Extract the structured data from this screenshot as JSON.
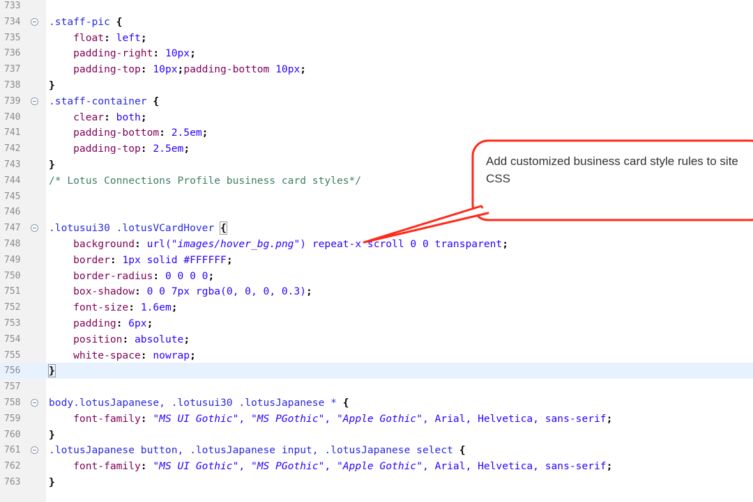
{
  "editor": {
    "lines": [
      {
        "n": "733",
        "fold": false,
        "tokens": []
      },
      {
        "n": "734",
        "fold": true,
        "tokens": [
          {
            "c": "sel",
            "t": ".staff-pic "
          },
          {
            "c": "br",
            "t": "{"
          }
        ]
      },
      {
        "n": "735",
        "fold": false,
        "tokens": [
          {
            "c": "prop",
            "t": "    float"
          },
          {
            "c": "br",
            "t": ": "
          },
          {
            "c": "val",
            "t": "left"
          },
          {
            "c": "br",
            "t": ";"
          }
        ]
      },
      {
        "n": "736",
        "fold": false,
        "tokens": [
          {
            "c": "prop",
            "t": "    padding-right"
          },
          {
            "c": "br",
            "t": ": "
          },
          {
            "c": "val",
            "t": "10px"
          },
          {
            "c": "br",
            "t": ";"
          }
        ]
      },
      {
        "n": "737",
        "fold": false,
        "tokens": [
          {
            "c": "prop",
            "t": "    padding-top"
          },
          {
            "c": "br",
            "t": ": "
          },
          {
            "c": "val",
            "t": "10px"
          },
          {
            "c": "br",
            "t": ";"
          },
          {
            "c": "prop",
            "t": "padding-bottom "
          },
          {
            "c": "val",
            "t": "10px"
          },
          {
            "c": "br",
            "t": ";"
          }
        ]
      },
      {
        "n": "738",
        "fold": false,
        "tokens": [
          {
            "c": "br",
            "t": "}"
          }
        ]
      },
      {
        "n": "739",
        "fold": true,
        "tokens": [
          {
            "c": "sel",
            "t": ".staff-container "
          },
          {
            "c": "br",
            "t": "{"
          }
        ]
      },
      {
        "n": "740",
        "fold": false,
        "tokens": [
          {
            "c": "prop",
            "t": "    clear"
          },
          {
            "c": "br",
            "t": ": "
          },
          {
            "c": "val",
            "t": "both"
          },
          {
            "c": "br",
            "t": ";"
          }
        ]
      },
      {
        "n": "741",
        "fold": false,
        "tokens": [
          {
            "c": "prop",
            "t": "    padding-bottom"
          },
          {
            "c": "br",
            "t": ": "
          },
          {
            "c": "val",
            "t": "2.5em"
          },
          {
            "c": "br",
            "t": ";"
          }
        ]
      },
      {
        "n": "742",
        "fold": false,
        "tokens": [
          {
            "c": "prop",
            "t": "    padding-top"
          },
          {
            "c": "br",
            "t": ": "
          },
          {
            "c": "val",
            "t": "2.5em"
          },
          {
            "c": "br",
            "t": ";"
          }
        ]
      },
      {
        "n": "743",
        "fold": false,
        "tokens": [
          {
            "c": "br",
            "t": "}"
          }
        ]
      },
      {
        "n": "744",
        "fold": false,
        "tokens": [
          {
            "c": "com",
            "t": "/* Lotus Connections Profile business card styles*/"
          }
        ]
      },
      {
        "n": "745",
        "fold": false,
        "tokens": []
      },
      {
        "n": "746",
        "fold": false,
        "tokens": []
      },
      {
        "n": "747",
        "fold": true,
        "tokens": [
          {
            "c": "sel",
            "t": ".lotusui30 .lotusVCardHover "
          },
          {
            "c": "br bracebox",
            "t": "{"
          }
        ]
      },
      {
        "n": "748",
        "fold": false,
        "tokens": [
          {
            "c": "prop",
            "t": "    background"
          },
          {
            "c": "br",
            "t": ": "
          },
          {
            "c": "val",
            "t": "url("
          },
          {
            "c": "str",
            "t": "\"images/hover_bg.png\""
          },
          {
            "c": "val",
            "t": ") repeat-x scroll 0 0 transparent"
          },
          {
            "c": "br",
            "t": ";"
          }
        ]
      },
      {
        "n": "749",
        "fold": false,
        "tokens": [
          {
            "c": "prop",
            "t": "    border"
          },
          {
            "c": "br",
            "t": ": "
          },
          {
            "c": "val",
            "t": "1px solid #FFFFFF"
          },
          {
            "c": "br",
            "t": ";"
          }
        ]
      },
      {
        "n": "750",
        "fold": false,
        "tokens": [
          {
            "c": "prop",
            "t": "    border-radius"
          },
          {
            "c": "br",
            "t": ": "
          },
          {
            "c": "val",
            "t": "0 0 0 0"
          },
          {
            "c": "br",
            "t": ";"
          }
        ]
      },
      {
        "n": "751",
        "fold": false,
        "tokens": [
          {
            "c": "prop",
            "t": "    box-shadow"
          },
          {
            "c": "br",
            "t": ": "
          },
          {
            "c": "val",
            "t": "0 0 7px rgba(0, 0, 0, 0.3)"
          },
          {
            "c": "br",
            "t": ";"
          }
        ]
      },
      {
        "n": "752",
        "fold": false,
        "tokens": [
          {
            "c": "prop",
            "t": "    font-size"
          },
          {
            "c": "br",
            "t": ": "
          },
          {
            "c": "val",
            "t": "1.6em"
          },
          {
            "c": "br",
            "t": ";"
          }
        ]
      },
      {
        "n": "753",
        "fold": false,
        "tokens": [
          {
            "c": "prop",
            "t": "    padding"
          },
          {
            "c": "br",
            "t": ": "
          },
          {
            "c": "val",
            "t": "6px"
          },
          {
            "c": "br",
            "t": ";"
          }
        ]
      },
      {
        "n": "754",
        "fold": false,
        "tokens": [
          {
            "c": "prop",
            "t": "    position"
          },
          {
            "c": "br",
            "t": ": "
          },
          {
            "c": "val",
            "t": "absolute"
          },
          {
            "c": "br",
            "t": ";"
          }
        ]
      },
      {
        "n": "755",
        "fold": false,
        "tokens": [
          {
            "c": "prop",
            "t": "    white-space"
          },
          {
            "c": "br",
            "t": ": "
          },
          {
            "c": "val",
            "t": "nowrap"
          },
          {
            "c": "br",
            "t": ";"
          }
        ]
      },
      {
        "n": "756",
        "fold": false,
        "current": true,
        "tokens": [
          {
            "c": "br bracebox",
            "t": "}"
          }
        ]
      },
      {
        "n": "757",
        "fold": false,
        "tokens": []
      },
      {
        "n": "758",
        "fold": true,
        "tokens": [
          {
            "c": "sel",
            "t": "body.lotusJapanese, .lotusui30 .lotusJapanese * "
          },
          {
            "c": "br",
            "t": "{"
          }
        ]
      },
      {
        "n": "759",
        "fold": false,
        "tokens": [
          {
            "c": "prop",
            "t": "    font-family"
          },
          {
            "c": "br",
            "t": ": "
          },
          {
            "c": "str",
            "t": "\"MS UI Gothic\""
          },
          {
            "c": "val",
            "t": ", "
          },
          {
            "c": "str",
            "t": "\"MS PGothic\""
          },
          {
            "c": "val",
            "t": ", "
          },
          {
            "c": "str",
            "t": "\"Apple Gothic\""
          },
          {
            "c": "val",
            "t": ", Arial, Helvetica, sans-serif"
          },
          {
            "c": "br",
            "t": ";"
          }
        ]
      },
      {
        "n": "760",
        "fold": false,
        "tokens": [
          {
            "c": "br",
            "t": "}"
          }
        ]
      },
      {
        "n": "761",
        "fold": true,
        "tokens": [
          {
            "c": "sel",
            "t": ".lotusJapanese button, .lotusJapanese input, .lotusJapanese select "
          },
          {
            "c": "br",
            "t": "{"
          }
        ]
      },
      {
        "n": "762",
        "fold": false,
        "tokens": [
          {
            "c": "prop",
            "t": "    font-family"
          },
          {
            "c": "br",
            "t": ": "
          },
          {
            "c": "str",
            "t": "\"MS UI Gothic\""
          },
          {
            "c": "val",
            "t": ", "
          },
          {
            "c": "str",
            "t": "\"MS PGothic\""
          },
          {
            "c": "val",
            "t": ", "
          },
          {
            "c": "str",
            "t": "\"Apple Gothic\""
          },
          {
            "c": "val",
            "t": ", Arial, Helvetica, sans-serif"
          },
          {
            "c": "br",
            "t": ";"
          }
        ]
      },
      {
        "n": "763",
        "fold": false,
        "tokens": [
          {
            "c": "br",
            "t": "}"
          }
        ]
      }
    ]
  },
  "callout": {
    "text": "Add customized business card style rules to site CSS",
    "color": "#ff2a1a"
  }
}
